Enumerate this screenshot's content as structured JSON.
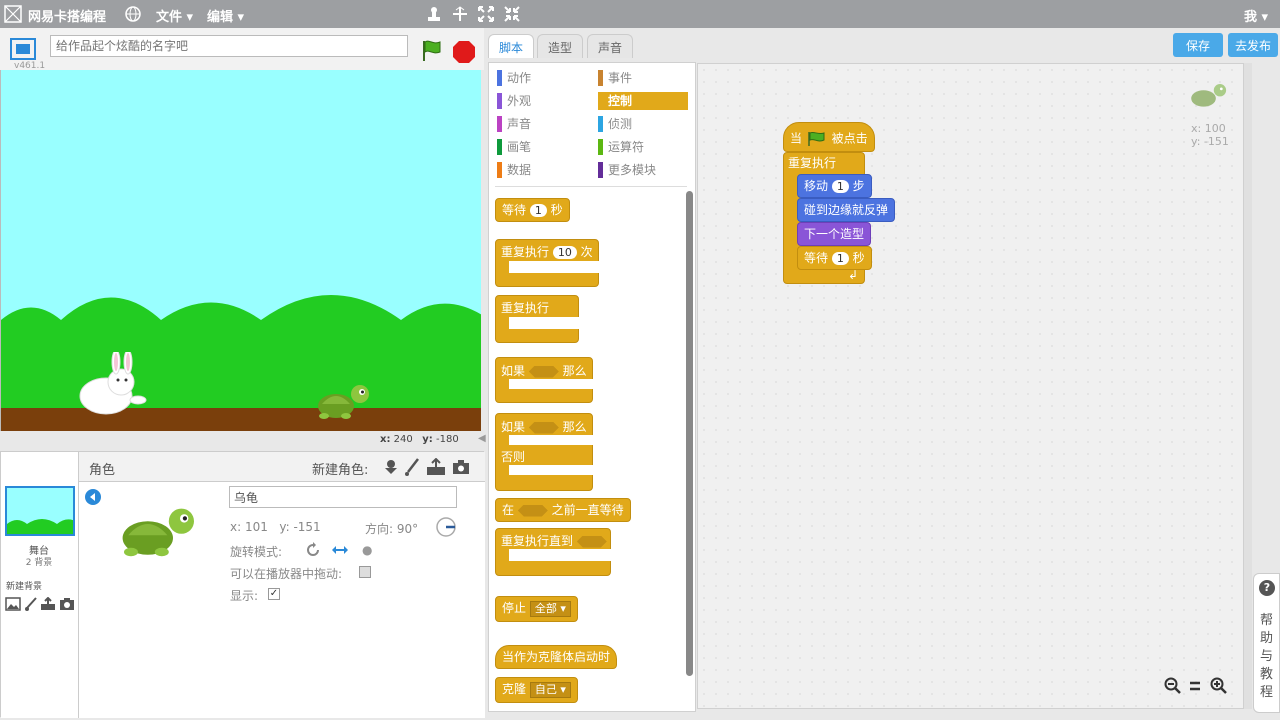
{
  "topbar": {
    "app_name": "网易卡搭编程",
    "menu_file": "文件",
    "menu_edit": "编辑",
    "user": "我"
  },
  "stage": {
    "project_name_placeholder": "给作品起个炫酷的名字吧",
    "version": "v461.1",
    "coord_x_label": "x:",
    "coord_x": "240",
    "coord_y_label": "y:",
    "coord_y": "-180"
  },
  "sprite_pane": {
    "header": "角色",
    "new_sprite": "新建角色:",
    "stage_label": "舞台",
    "stage_backdrops": "2 背景",
    "new_backdrop": "新建背景",
    "sprite_name": "乌龟",
    "x_label": "x:",
    "x": "101",
    "y_label": "y:",
    "y": "-151",
    "direction_label": "方向:",
    "direction": "90°",
    "rotation_label": "旋转模式:",
    "draggable_label": "可以在播放器中拖动:",
    "show_label": "显示:"
  },
  "tabs": [
    "脚本",
    "造型",
    "声音"
  ],
  "categories_left": [
    "动作",
    "外观",
    "声音",
    "画笔",
    "数据"
  ],
  "categories_right": [
    "事件",
    "控制",
    "侦测",
    "运算符",
    "更多模块"
  ],
  "category_colors": {
    "motion": "#4c73e0",
    "looks": "#8a55d7",
    "sound": "#bb42c3",
    "pen": "#0e9a3c",
    "data": "#ee7d16",
    "events": "#c88330",
    "control": "#e1a91a",
    "sensing": "#2ca5e2",
    "operators": "#5cb712",
    "more": "#632d99"
  },
  "palette": {
    "wait": "等待",
    "wait_num": "1",
    "sec": "秒",
    "repeat": "重复执行",
    "repeat_num": "10",
    "times": "次",
    "forever": "重复执行",
    "if": "如果",
    "then": "那么",
    "if2": "如果",
    "then2": "那么",
    "else": "否则",
    "wait_until_a": "在",
    "wait_until_b": "之前一直等待",
    "repeat_until": "重复执行直到",
    "stop": "停止",
    "stop_opt": "全部",
    "clone_start": "当作为克隆体启动时",
    "clone": "克隆",
    "clone_opt": "自己"
  },
  "script": {
    "when": "当",
    "clicked": "被点击",
    "forever": "重复执行",
    "move": "移动",
    "move_num": "1",
    "steps": "步",
    "bounce": "碰到边缘就反弹",
    "next_costume": "下一个造型",
    "wait": "等待",
    "wait_num": "1",
    "sec": "秒"
  },
  "scripts_area": {
    "x_label": "x:",
    "x": "100",
    "y_label": "y:",
    "y": "-151"
  },
  "buttons": {
    "save": "保存",
    "publish": "去发布"
  },
  "help": {
    "q": "?",
    "text": "帮助与教程"
  }
}
